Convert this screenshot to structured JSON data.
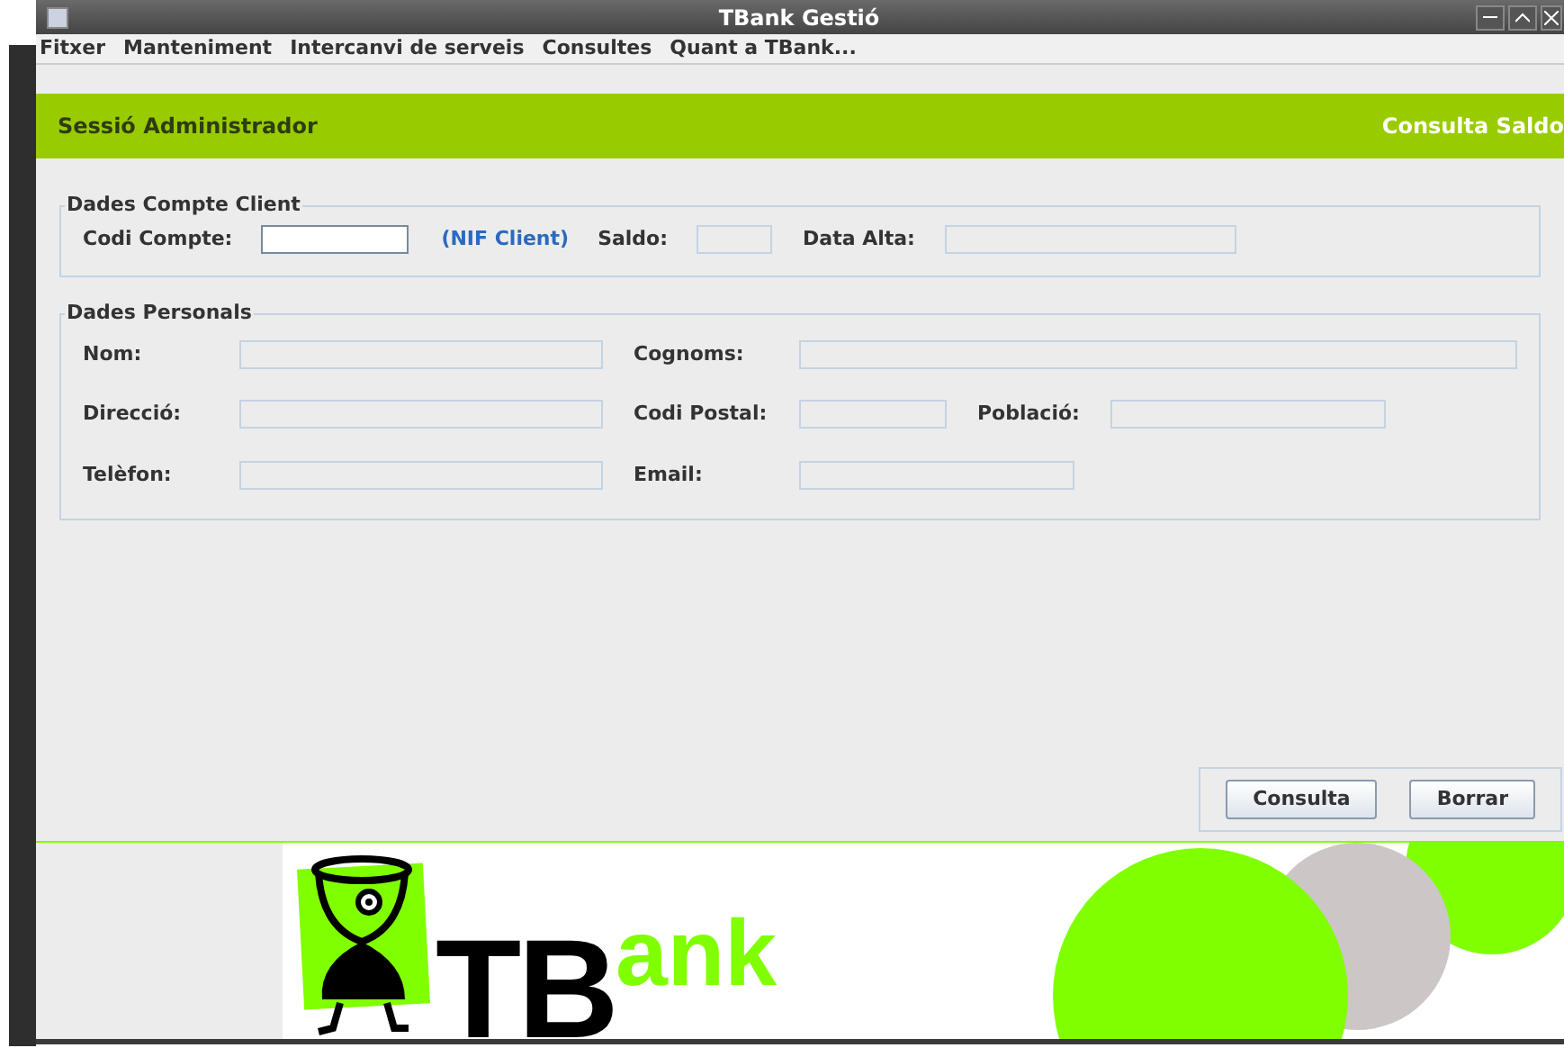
{
  "window": {
    "title": "TBank Gestió"
  },
  "menu": [
    "Fitxer",
    "Manteniment",
    "Intercanvi de serveis",
    "Consultes",
    "Quant a TBank..."
  ],
  "header": {
    "session": "Sessió Administrador",
    "screen": "Consulta Saldo"
  },
  "account_section": {
    "title": "Dades Compte Client",
    "code_label": "Codi Compte:",
    "nif_link": "(NIF Client)",
    "balance_label": "Saldo:",
    "date_label": "Data Alta:"
  },
  "personal_section": {
    "title": "Dades Personals",
    "rows": [
      [
        {
          "label": "Nom:"
        },
        {
          "label": "Cognoms:"
        }
      ],
      [
        {
          "label": "Direcció:"
        },
        {
          "label": "Codi Postal:"
        },
        {
          "label": "Població:"
        }
      ],
      [
        {
          "label": "Telèfon:"
        },
        {
          "label": "Email:"
        }
      ]
    ]
  },
  "buttons": [
    "Consulta",
    "Borrar"
  ],
  "banner": {
    "logo_main": "TB",
    "logo_rest": "ank"
  }
}
